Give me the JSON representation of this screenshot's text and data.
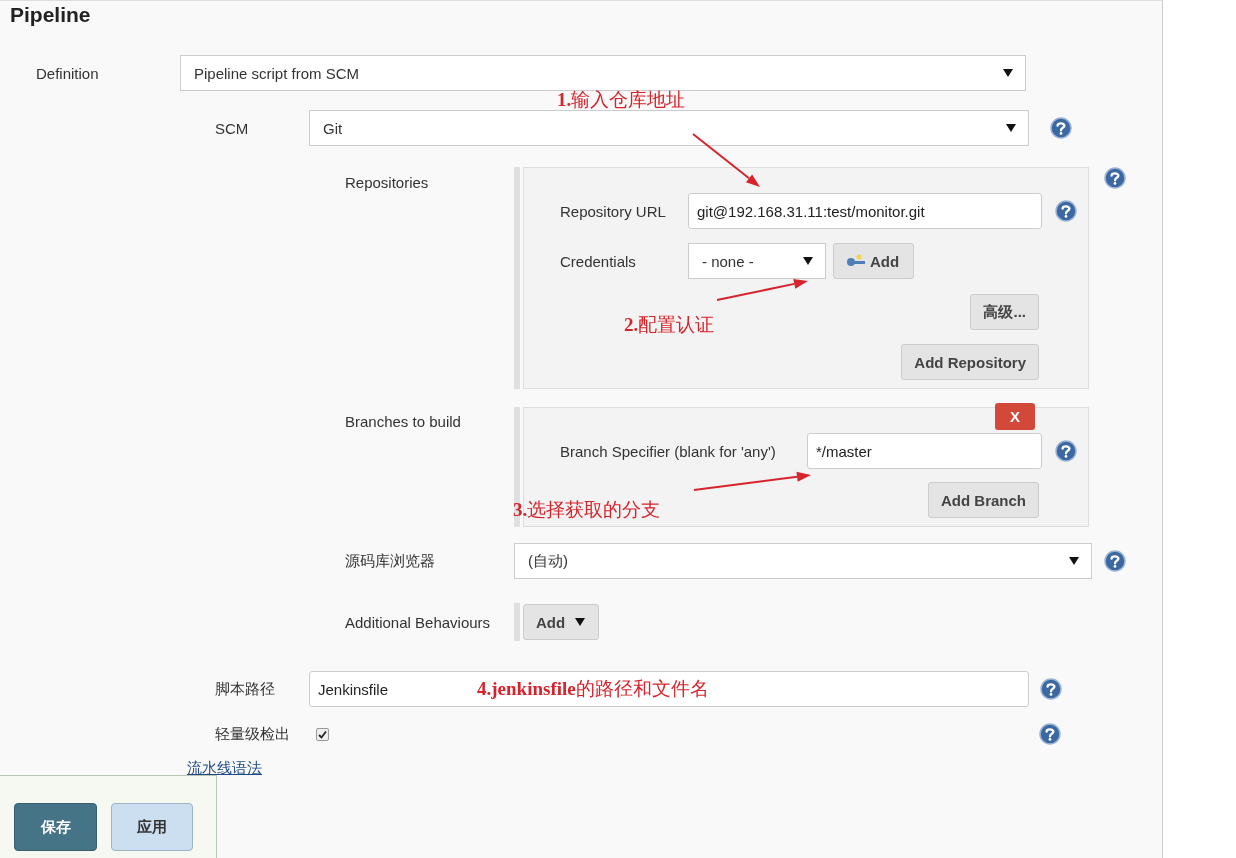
{
  "section_title": "Pipeline",
  "definition": {
    "label": "Definition",
    "value": "Pipeline script from SCM"
  },
  "scm": {
    "label": "SCM",
    "value": "Git"
  },
  "repositories": {
    "label": "Repositories",
    "url_label": "Repository URL",
    "url_value": "git@192.168.31.11:test/monitor.git",
    "credentials_label": "Credentials",
    "credentials_value": "- none -",
    "add_button": "Add",
    "advanced_button": "高级...",
    "add_repository_button": "Add Repository"
  },
  "branches": {
    "label": "Branches to build",
    "delete_button": "X",
    "specifier_label": "Branch Specifier (blank for 'any')",
    "specifier_value": "*/master",
    "add_branch_button": "Add Branch"
  },
  "browser": {
    "label": "源码库浏览器",
    "value": "(自动)"
  },
  "additional_behaviours": {
    "label": "Additional Behaviours",
    "add_button": "Add"
  },
  "script_path": {
    "label": "脚本路径",
    "value": "Jenkinsfile"
  },
  "lightweight_checkout": {
    "label": "轻量级检出",
    "checked": true
  },
  "syntax_link": "流水线语法",
  "buttons": {
    "save": "保存",
    "apply": "应用"
  },
  "annotations": [
    {
      "text": "**1.**输入仓库地址"
    },
    {
      "text": "**2.**配置认证"
    },
    {
      "text": "**3.**选择获取的分支"
    },
    {
      "text": "**4.jenkinsfile**的路径和文件名"
    }
  ]
}
